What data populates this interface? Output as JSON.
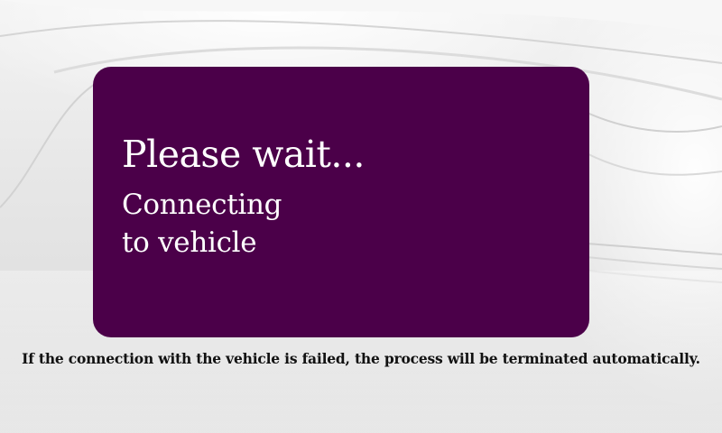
{
  "dialog": {
    "title": "Please wait...",
    "subtitle": "Connecting\nto vehicle",
    "background_color": "#4b0049",
    "text_color": "#ffffff"
  },
  "footer": {
    "note": "If the connection with the vehicle is failed, the process will be terminated automatically."
  }
}
